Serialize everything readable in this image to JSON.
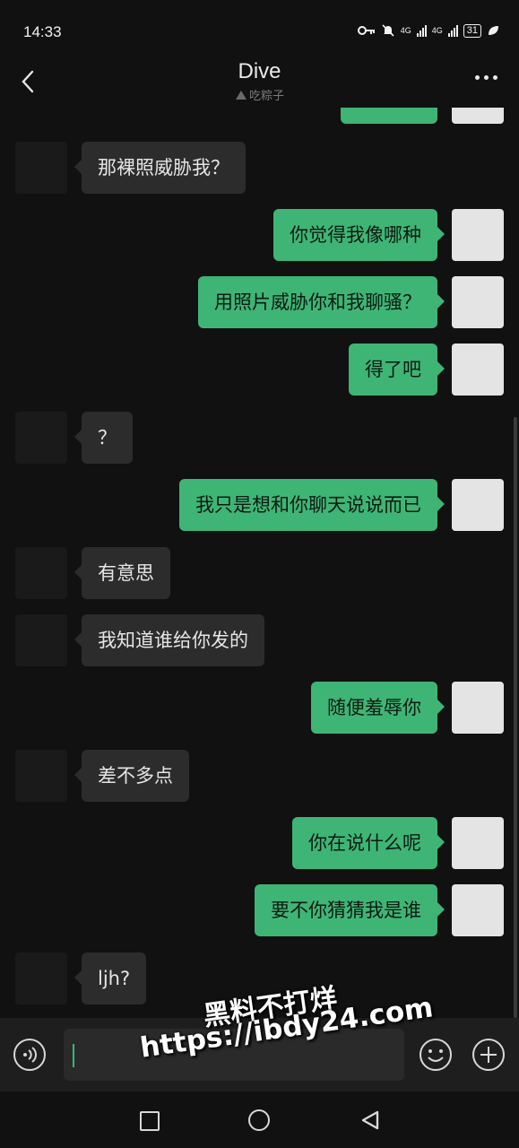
{
  "status_bar": {
    "time": "14:33",
    "net1": "4G",
    "net2": "4G",
    "battery": "31"
  },
  "header": {
    "title": "Dive",
    "subtitle": "吃粽子"
  },
  "messages": [
    {
      "side": "out",
      "text": ""
    },
    {
      "side": "in",
      "text": "那裸照威胁我？"
    },
    {
      "side": "out",
      "text": "你觉得我像哪种"
    },
    {
      "side": "out",
      "text": "用照片威胁你和我聊骚？"
    },
    {
      "side": "out",
      "text": "得了吧"
    },
    {
      "side": "in",
      "text": "？"
    },
    {
      "side": "out",
      "text": "我只是想和你聊天说说而已"
    },
    {
      "side": "in",
      "text": "有意思"
    },
    {
      "side": "in",
      "text": "我知道谁给你发的"
    },
    {
      "side": "out",
      "text": "随便羞辱你"
    },
    {
      "side": "in",
      "text": "差不多点"
    },
    {
      "side": "out",
      "text": "你在说什么呢"
    },
    {
      "side": "out",
      "text": "要不你猜猜我是谁"
    },
    {
      "side": "in",
      "text": "ljh?"
    }
  ],
  "watermark": {
    "line1": "黑料不打烊",
    "line2": "https://ibdy24.com"
  },
  "colors": {
    "background": "#111111",
    "incoming_bubble": "#2c2c2c",
    "outgoing_bubble": "#3eb575",
    "input_bar": "#1e1e1e"
  }
}
